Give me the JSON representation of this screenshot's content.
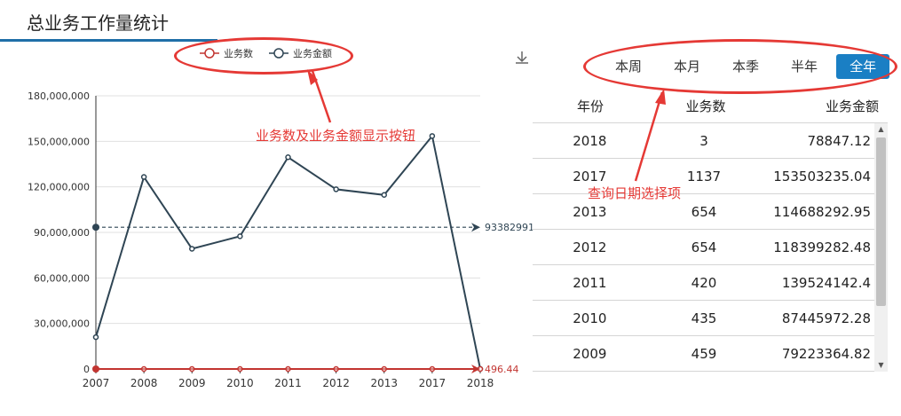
{
  "page": {
    "title": "总业务工作量统计"
  },
  "legend": {
    "items": [
      {
        "label": "业务数",
        "color": "#c23531"
      },
      {
        "label": "业务金额",
        "color": "#2f4554"
      }
    ]
  },
  "toolbar": {
    "download_icon": "download-icon"
  },
  "period_selector": {
    "options": [
      "本周",
      "本月",
      "本季",
      "半年",
      "全年"
    ],
    "active": "全年",
    "active_color": "#1a7fc4"
  },
  "table": {
    "headers": [
      "年份",
      "业务数",
      "业务金额"
    ],
    "rows": [
      [
        "2018",
        "3",
        "78847.12"
      ],
      [
        "2017",
        "1137",
        "153503235.04"
      ],
      [
        "2013",
        "654",
        "114688292.95"
      ],
      [
        "2012",
        "654",
        "118399282.48"
      ],
      [
        "2011",
        "420",
        "139524142.4"
      ],
      [
        "2010",
        "435",
        "87445972.28"
      ],
      [
        "2009",
        "459",
        "79223364.82"
      ]
    ]
  },
  "annotations": {
    "legend_note": "业务数及业务金额显示按钮",
    "period_note": "查询日期选择项",
    "color": "#e53935"
  },
  "chart_data": {
    "type": "line",
    "categories": [
      "2007",
      "2008",
      "2009",
      "2010",
      "2011",
      "2012",
      "2013",
      "2017",
      "2018"
    ],
    "series": [
      {
        "name": "业务数",
        "color": "#c23531",
        "values": [
          100,
          459,
          459,
          435,
          420,
          654,
          654,
          1137,
          3
        ],
        "mark_line": {
          "value": "496.44"
        }
      },
      {
        "name": "业务金额",
        "color": "#2f4554",
        "values": [
          21000000,
          126500000,
          79223364.82,
          87445972.28,
          139524142.4,
          118399282.48,
          114688292.95,
          153503235.04,
          78847.12
        ],
        "mark_line": {
          "value": "93382991"
        }
      }
    ],
    "y_ticks": [
      "0",
      "30,000,000",
      "60,000,000",
      "90,000,000",
      "120,000,000",
      "150,000,000",
      "180,000,000"
    ],
    "ylim": [
      0,
      180000000
    ],
    "grid": true,
    "legend": "top-center"
  }
}
